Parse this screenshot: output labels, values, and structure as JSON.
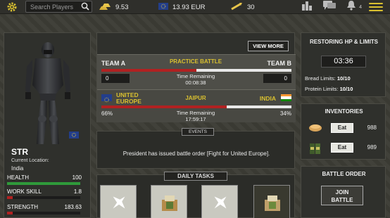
{
  "topbar": {
    "search_placeholder": "Search Players",
    "gold_value": "9.53",
    "eur_value": "13.93 EUR",
    "ammo_value": "30",
    "notifications_count": "4",
    "accent_color": "#d9c030"
  },
  "player": {
    "name": "STR",
    "location_label": "Current Location:",
    "location_value": "India",
    "health_label": "HEALTH",
    "health_value": "100",
    "health_fill": 1.0,
    "work_label": "WORK SKILL",
    "work_value": "1.8",
    "work_fill": 0.08,
    "strength_label": "STRENGTH",
    "strength_value": "183.63",
    "strength_fill": 0.08
  },
  "battles": {
    "view_more": "VIEW MORE",
    "practice": {
      "team_a": "TEAM A",
      "team_b": "TEAM B",
      "name": "PRACTICE BATTLE",
      "score_a": "0",
      "score_b": "0",
      "time_label": "Time Remaining",
      "time_value": "00:08:38",
      "progress": 0.5
    },
    "jaipur": {
      "team_a": "UNITED EUROPE",
      "team_b": "INDIA",
      "name": "JAIPUR",
      "pct_a": "66%",
      "pct_b": "34%",
      "time_label": "Time Remaining",
      "time_value": "17:59:17",
      "progress": 0.66
    }
  },
  "events": {
    "tab_label": "EVENTS",
    "text": "President has issued battle order [Fight for United Europe]."
  },
  "daily_tasks": {
    "tab_label": "DAILY TASKS"
  },
  "restore": {
    "title": "RESTORING HP & LIMITS",
    "timer": "03:36",
    "bread_label": "Bread Limits:",
    "bread_value": "10/10",
    "protein_label": "Protein Limits:",
    "protein_value": "10/10"
  },
  "inventories": {
    "title": "INVENTORIES",
    "items": [
      {
        "icon": "bread-icon",
        "button": "Eat",
        "count": "988"
      },
      {
        "icon": "protein-can-icon",
        "button": "Eat",
        "count": "989"
      }
    ]
  },
  "battle_order": {
    "title": "BATTLE ORDER",
    "join_line1": "JOIN",
    "join_line2": "BATTLE"
  },
  "colors": {
    "health": "#2f9a3a",
    "work": "#b12121",
    "strength": "#b12121",
    "eu_blue": "#233e8b",
    "india_saffron": "#ff9933",
    "india_green": "#138808"
  }
}
